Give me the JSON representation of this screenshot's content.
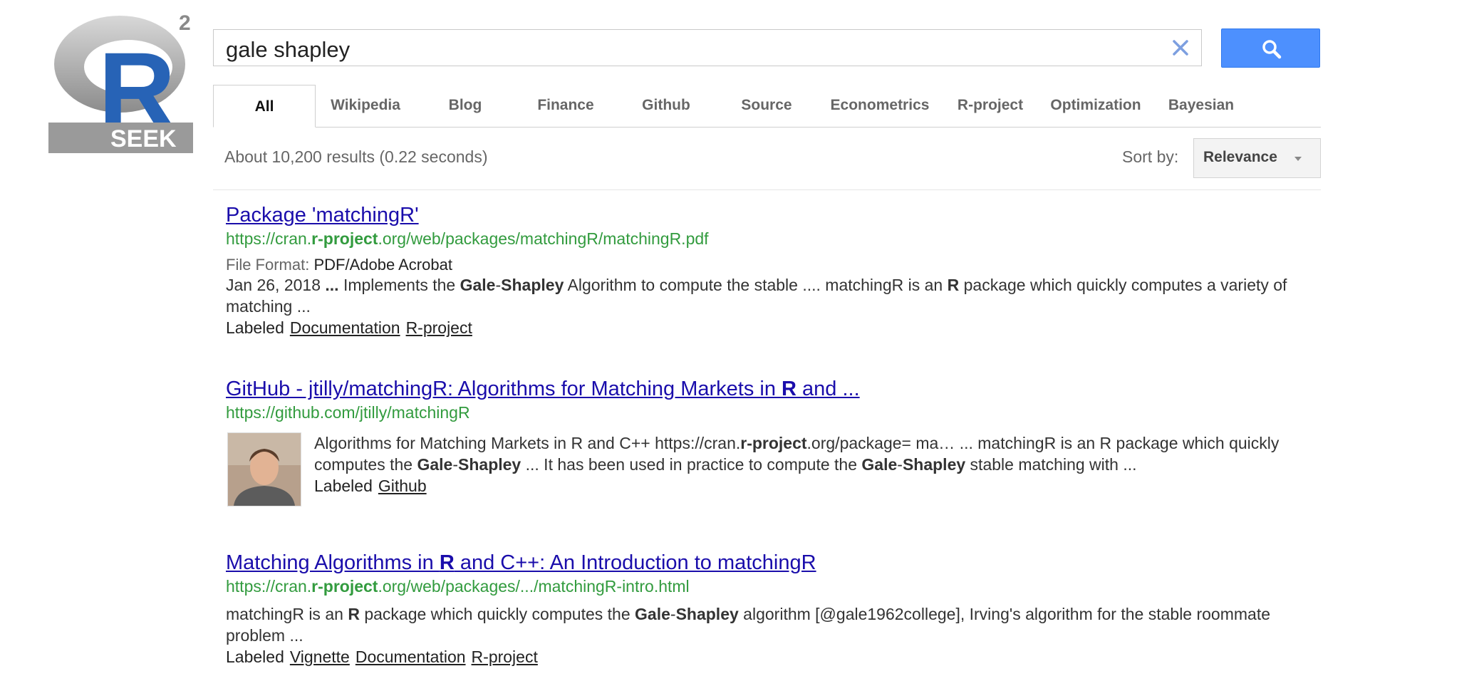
{
  "logo": {
    "letter": "R",
    "superscript": "2",
    "wordmark": "SEEK"
  },
  "search": {
    "query": "gale shapley"
  },
  "tabs": [
    "All",
    "Wikipedia",
    "Blog",
    "Finance",
    "Github",
    "Source",
    "Econometrics",
    "R-project",
    "Optimization",
    "Bayesian"
  ],
  "active_tab": "All",
  "stats": "About 10,200 results (0.22 seconds)",
  "sort": {
    "label": "Sort by:",
    "value": "Relevance"
  },
  "results": [
    {
      "title": "Package 'matchingR'",
      "url_pre": "https://cran.",
      "url_bold": "r-project",
      "url_post": ".org/web/packages/matchingR/matchingR.pdf",
      "file_format_label": "File Format:",
      "file_format_value": "PDF/Adobe Acrobat",
      "snippet_html": "Jan 26, 2018 <b>...</b> Implements the <b>Gale</b>-<b>Shapley</b> Algorithm to compute the stable .... matchingR is an <b>R</b> package which quickly computes a variety of matching ...",
      "labeled": "Labeled",
      "labels": [
        "Documentation",
        "R-project"
      ]
    },
    {
      "title_pre": "GitHub - jtilly/matchingR: Algorithms for Matching Markets in ",
      "title_bold": "R",
      "title_post": " and ...",
      "url": "https://github.com/jtilly/matchingR",
      "snippet_html": "Algorithms for Matching Markets in R and C++ https://cran.<b>r-project</b>.org/package= ma… ... matchingR is an R package which quickly computes the <b>Gale</b>-<b>Shapley</b> ... It has been used in practice to compute the <b>Gale</b>-<b>Shapley</b> stable matching with ...",
      "labeled": "Labeled",
      "labels": [
        "Github"
      ]
    },
    {
      "title_pre": "Matching Algorithms in ",
      "title_bold": "R",
      "title_post": " and C++: An Introduction to matchingR",
      "url_pre": "https://cran.",
      "url_bold": "r-project",
      "url_post": ".org/web/packages/.../matchingR-intro.html",
      "snippet_html": "matchingR is an <b>R</b> package which quickly computes the <b>Gale</b>-<b>Shapley</b> algorithm [@gale1962college], Irving's algorithm for the stable roommate problem ...",
      "labeled": "Labeled",
      "labels": [
        "Vignette",
        "Documentation",
        "R-project"
      ]
    }
  ]
}
